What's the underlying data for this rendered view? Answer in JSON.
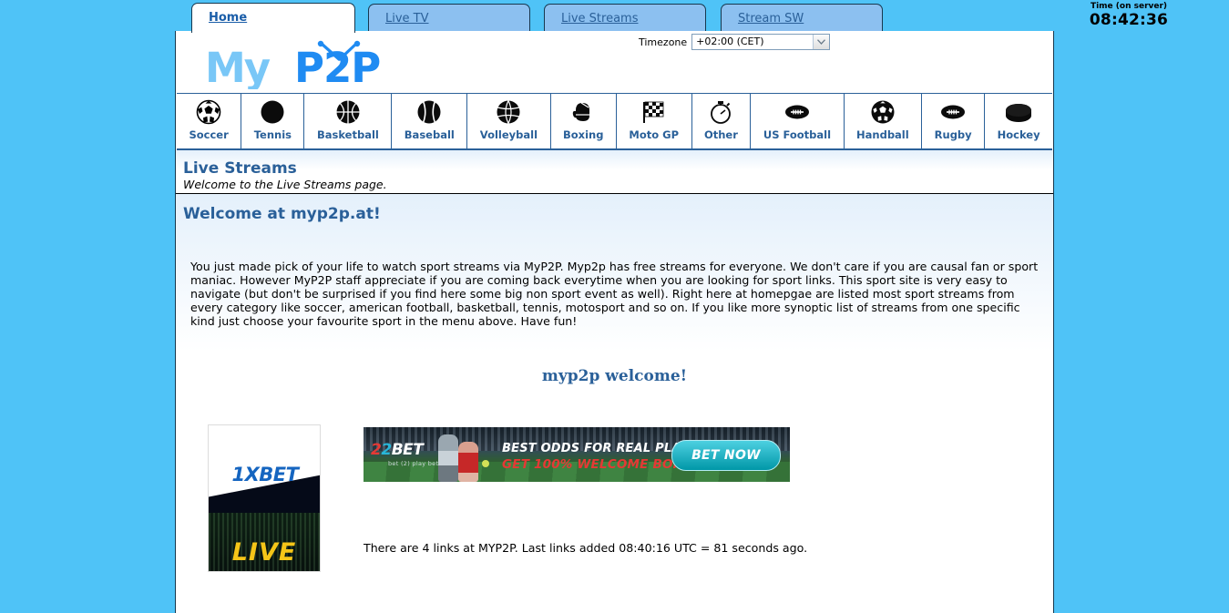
{
  "browser": {
    "tabs": [
      {
        "label": "Home",
        "active": true
      },
      {
        "label": "Live TV",
        "active": false
      },
      {
        "label": "Live Streams",
        "active": false
      },
      {
        "label": "Stream SW",
        "active": false
      }
    ]
  },
  "server_time": {
    "label": "Time (on server)",
    "value": "08:42:36"
  },
  "site": {
    "logo_text": "MyP2P",
    "accent_color": "#1f8bf2",
    "heading_color": "#2a6099"
  },
  "timezone": {
    "label": "Timezone",
    "selected": "+02:00 (CET)",
    "options": [
      "+02:00 (CET)"
    ]
  },
  "sports_menu": [
    {
      "label": "Soccer",
      "icon": "soccer-ball-icon"
    },
    {
      "label": "Tennis",
      "icon": "tennis-ball-icon"
    },
    {
      "label": "Basketball",
      "icon": "basketball-icon"
    },
    {
      "label": "Baseball",
      "icon": "baseball-icon"
    },
    {
      "label": "Volleyball",
      "icon": "volleyball-icon"
    },
    {
      "label": "Boxing",
      "icon": "boxing-glove-icon"
    },
    {
      "label": "Moto GP",
      "icon": "checkered-flag-icon"
    },
    {
      "label": "Other",
      "icon": "stopwatch-icon"
    },
    {
      "label": "US Football",
      "icon": "american-football-icon"
    },
    {
      "label": "Handball",
      "icon": "handball-icon"
    },
    {
      "label": "Rugby",
      "icon": "rugby-ball-icon"
    },
    {
      "label": "Hockey",
      "icon": "hockey-puck-icon"
    }
  ],
  "live_streams_band": {
    "title": "Live Streams",
    "subtitle": "Welcome to the Live Streams page."
  },
  "welcome": {
    "title": "Welcome at myp2p.at!",
    "body": "You just made pick of your life to watch sport streams via MyP2P. Myp2p has free streams for everyone. We don't care if you are causal fan or sport maniac. However MyP2P staff appreciate if you are coming back everytime when you are looking for sport links. This sport site is very easy to navigate (but don't be surprised if you find here some big non sport event as well). Right here at homepgae are listed most sport streams from every category like soccer, american football, basketball, tennis, motosport and so on. If you like more synoptic list of streams from one specific kind just choose your favourite sport in the menu above. Have fun!",
    "sub_heading": "myp2p welcome!"
  },
  "ads": {
    "sidebar": {
      "brand": "1XBET",
      "caption": "LIVE"
    },
    "banner": {
      "brand_prefix": "2",
      "brand_prefix2": "2",
      "brand": "BET",
      "tagline": "bet (2) play  bet (2) win",
      "line1": "BEST ODDS FOR REAL PLAYERS",
      "line2": "GET 100% WELCOME BONUS",
      "cta": "BET NOW"
    }
  },
  "links_status": "There are 4 links at MYP2P. Last links added 08:40:16 UTC = 81 seconds ago."
}
